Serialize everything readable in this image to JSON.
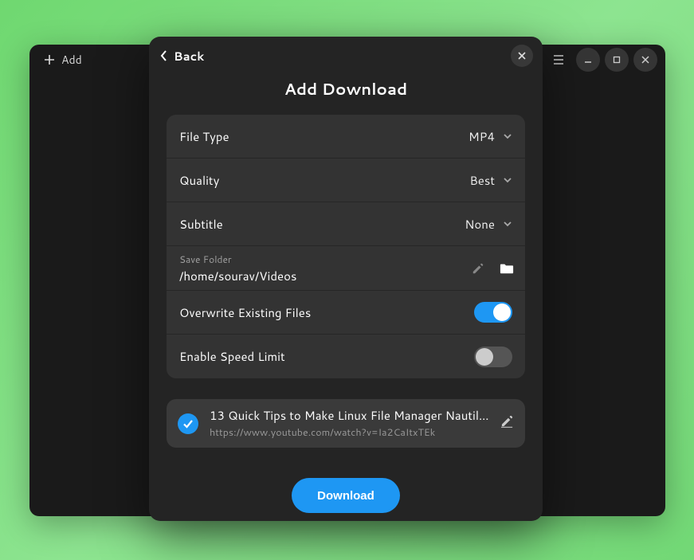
{
  "bg": {
    "add_label": "Add"
  },
  "modal": {
    "back_label": "Back",
    "title": "Add Download",
    "rows": {
      "file_type": {
        "label": "File Type",
        "value": "MP4"
      },
      "quality": {
        "label": "Quality",
        "value": "Best"
      },
      "subtitle": {
        "label": "Subtitle",
        "value": "None"
      },
      "save_folder": {
        "label": "Save Folder",
        "path": "/home/sourav/Videos"
      },
      "overwrite": {
        "label": "Overwrite Existing Files",
        "on": true
      },
      "speed_limit": {
        "label": "Enable Speed Limit",
        "on": false
      }
    },
    "item": {
      "title": "13 Quick Tips to Make Linux File Manager Nautil…",
      "url": "https://www.youtube.com/watch?v=Ia2CaItxTEk"
    },
    "download_label": "Download"
  }
}
